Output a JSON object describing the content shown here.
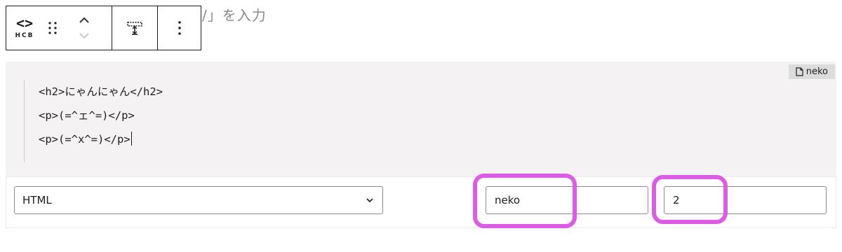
{
  "background_heading": "/」を入力",
  "toolbar": {
    "hcb_glyph": "<>",
    "hcb_label": "HCB",
    "drag_icon": "drag-handle-icon",
    "move_up_icon": "chevron-up-icon",
    "move_down_icon": "chevron-down-icon",
    "height_icon": "block-height-icon",
    "more_icon": "more-vertical-icon"
  },
  "code_block": {
    "file_badge": "neko",
    "lines": [
      "<h2>にゃんにゃん</h2>",
      "<p>(=^ェ^=)</p>",
      "<p>(=^x^=)</p>"
    ]
  },
  "settings": {
    "language_selected": "HTML",
    "file_name_value": "neko",
    "start_line_value": "2"
  },
  "colors": {
    "highlight": "#dc5ce6",
    "code_bg": "#f4f2f2",
    "badge_bg": "#dcdcdc"
  }
}
